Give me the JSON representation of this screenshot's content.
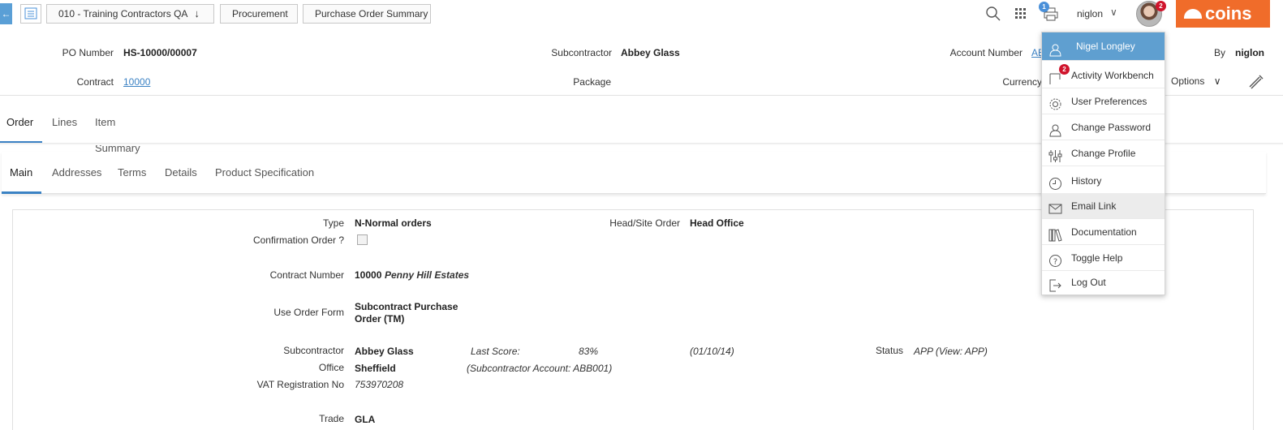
{
  "topbar": {
    "breadcrumbs": [
      "010 - Training Contractors QA",
      "Procurement",
      "Purchase Order Summary"
    ],
    "printer_badge": "1",
    "username": "niglon",
    "avatar_badge": "2",
    "logo_text": "coins"
  },
  "header": {
    "po_number_label": "PO Number",
    "po_number": "HS-10000/00007",
    "subcontractor_label": "Subcontractor",
    "subcontractor": "Abbey Glass",
    "account_number_label": "Account Number",
    "account_number": "AB",
    "by_label": "By",
    "by": "niglon",
    "contract_label": "Contract",
    "contract": "10000",
    "package_label": "Package",
    "currency_label": "Currency",
    "options_label": "Options"
  },
  "tabs": [
    "Order",
    "Lines",
    "Item Summary"
  ],
  "subtabs": [
    "Main",
    "Addresses",
    "Terms",
    "Details",
    "Product Specification"
  ],
  "form": {
    "type_label": "Type",
    "type": "N-Normal orders",
    "head_site_label": "Head/Site Order",
    "head_site": "Head Office",
    "confirmation_label": "Confirmation Order ?",
    "contract_number_label": "Contract Number",
    "contract_number": "10000",
    "contract_name": "Penny Hill Estates",
    "use_order_form_label": "Use Order Form",
    "use_order_form_1": "Subcontract Purchase",
    "use_order_form_2": "Order (TM)",
    "subcontractor_label": "Subcontractor",
    "subcontractor": "Abbey Glass",
    "last_score_label": "Last Score:",
    "last_score": "83%",
    "score_date": "(01/10/14)",
    "status_label": "Status",
    "status": "APP (View: APP)",
    "office_label": "Office",
    "office": "Sheffield",
    "sub_account": "(Subcontractor Account: ABB001)",
    "vat_label": "VAT Registration No",
    "vat": "753970208",
    "trade_label": "Trade",
    "trade": "GLA"
  },
  "user_menu": {
    "user_name": "Nigel Longley",
    "workbench_badge": "2",
    "items": [
      "Activity Workbench",
      "User Preferences",
      "Change Password",
      "Change Profile",
      "History",
      "Email Link",
      "Documentation",
      "Toggle Help",
      "Log Out"
    ]
  }
}
